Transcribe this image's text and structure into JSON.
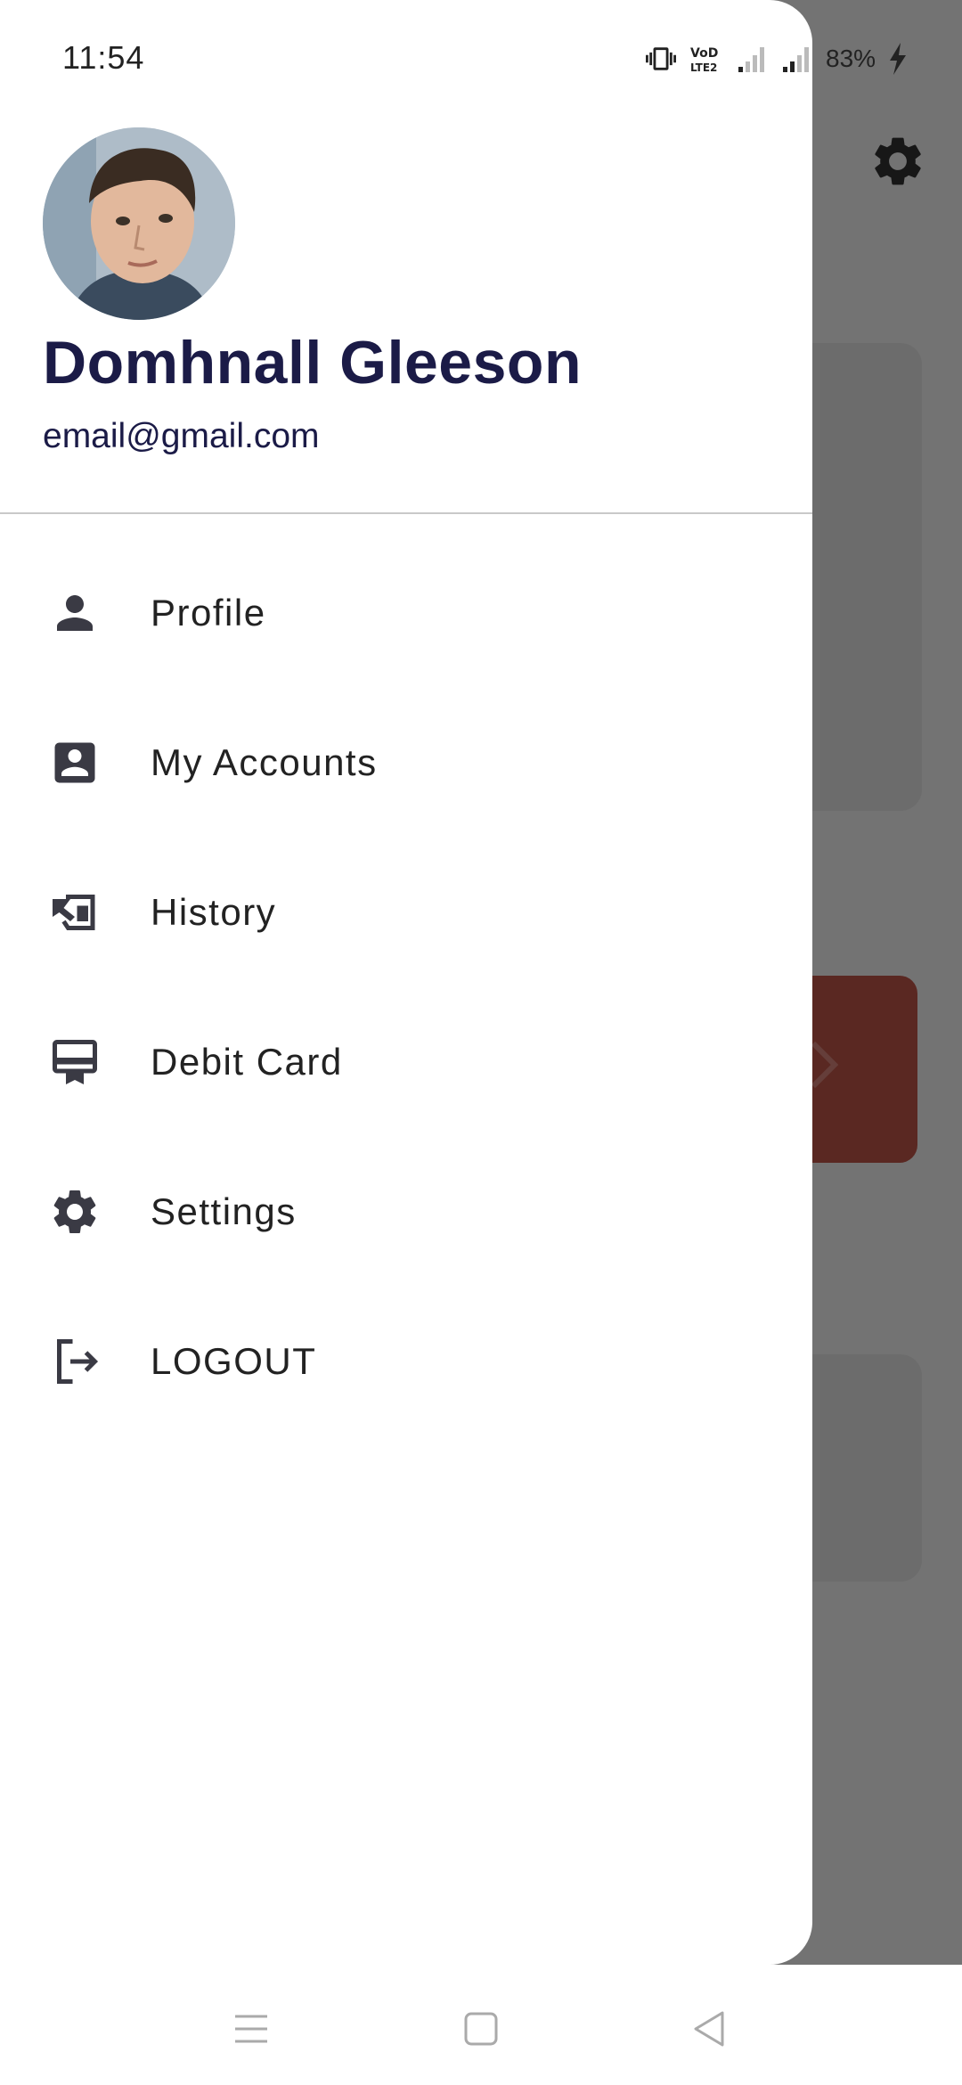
{
  "status_bar": {
    "time": "11:54",
    "battery": "83%"
  },
  "user": {
    "name": "Domhnall Gleeson",
    "email": "email@gmail.com"
  },
  "menu": [
    {
      "label": "Profile",
      "icon": "person-icon"
    },
    {
      "label": "My Accounts",
      "icon": "account-box-icon"
    },
    {
      "label": "History",
      "icon": "history-icon"
    },
    {
      "label": "Debit Card",
      "icon": "card-icon"
    },
    {
      "label": "Settings",
      "icon": "gear-icon"
    },
    {
      "label": "LOGOUT",
      "icon": "logout-icon"
    }
  ],
  "colors": {
    "name_text": "#1b1b47",
    "icon": "#3a3a44",
    "scrim": "#000000",
    "accent_card": "#c85a4d"
  },
  "nav_bar": {
    "icons": [
      "menu-lines-icon",
      "home-square-icon",
      "back-triangle-icon"
    ]
  }
}
